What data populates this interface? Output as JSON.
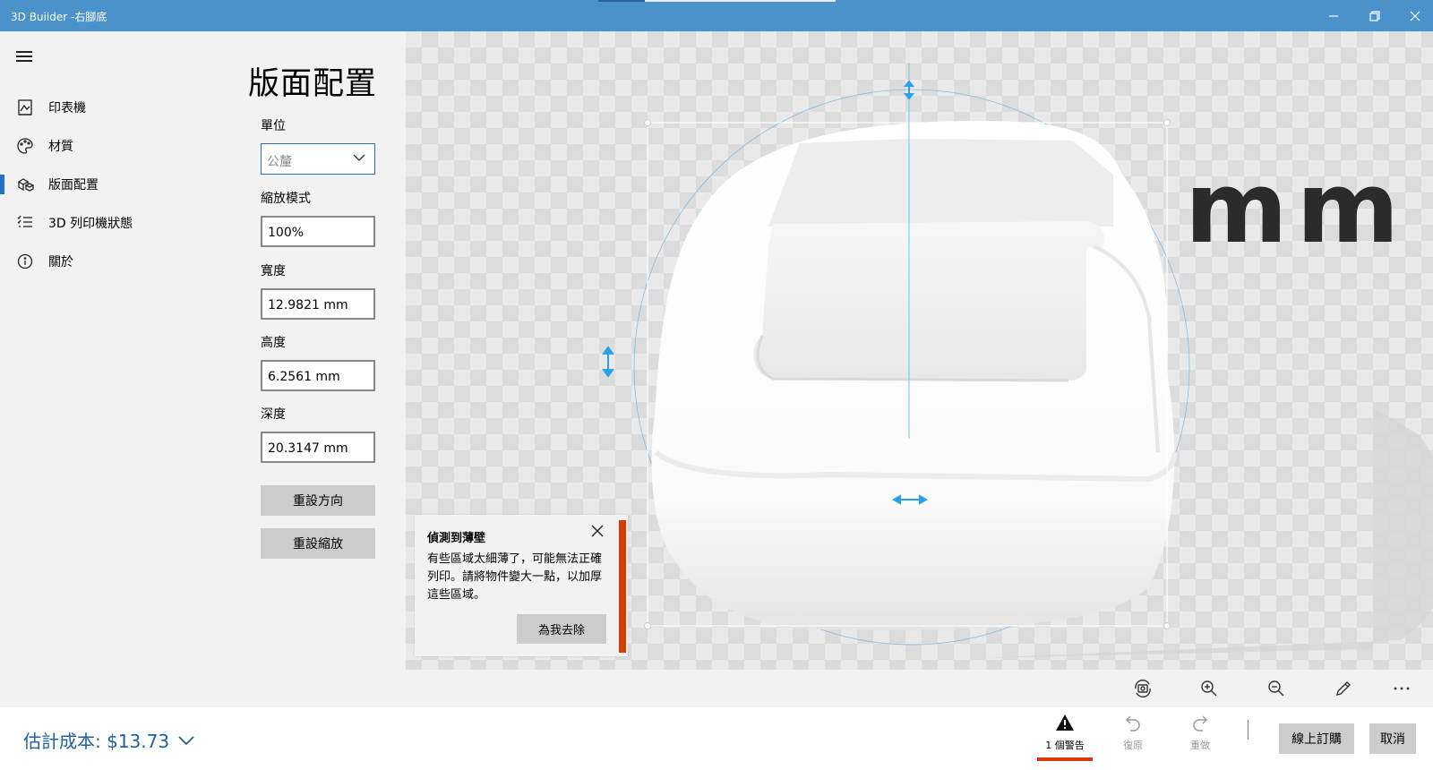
{
  "window": {
    "title": "3D Builder -右腳底"
  },
  "nav": {
    "items": [
      {
        "label": "印表機",
        "icon": "printer-icon"
      },
      {
        "label": "材質",
        "icon": "palette-icon"
      },
      {
        "label": "版面配置",
        "icon": "layout-icon",
        "active": true
      },
      {
        "label": "3D 列印機狀態",
        "icon": "status-list-icon"
      },
      {
        "label": "關於",
        "icon": "info-icon"
      }
    ]
  },
  "panel": {
    "title": "版面配置",
    "unit_label": "單位",
    "unit_value": "公釐",
    "scale_label": "縮放模式",
    "scale_value": "100%",
    "width_label": "寬度",
    "width_value": "12.9821 mm",
    "height_label": "高度",
    "height_value": "6.2561 mm",
    "depth_label": "深度",
    "depth_value": "20.3147 mm",
    "reset_orientation": "重設方向",
    "reset_scale": "重設縮放"
  },
  "viewport": {
    "unit_watermark": "mm"
  },
  "toast": {
    "title": "偵測到薄壁",
    "body": "有些區域太細薄了，可能無法正確列印。請將物件變大一點，以加厚這些區域。",
    "action": "為我去除"
  },
  "bottom": {
    "cost": "估計成本: $13.73",
    "warning_label": "1 個警告",
    "undo_label": "復原",
    "redo_label": "重做",
    "order_label": "線上訂購",
    "cancel_label": "取消"
  },
  "colors": {
    "accent": "#1f73c9",
    "titlebar": "#4a92c9",
    "warning": "#d83b01",
    "cost_text": "#1f5f9e"
  }
}
